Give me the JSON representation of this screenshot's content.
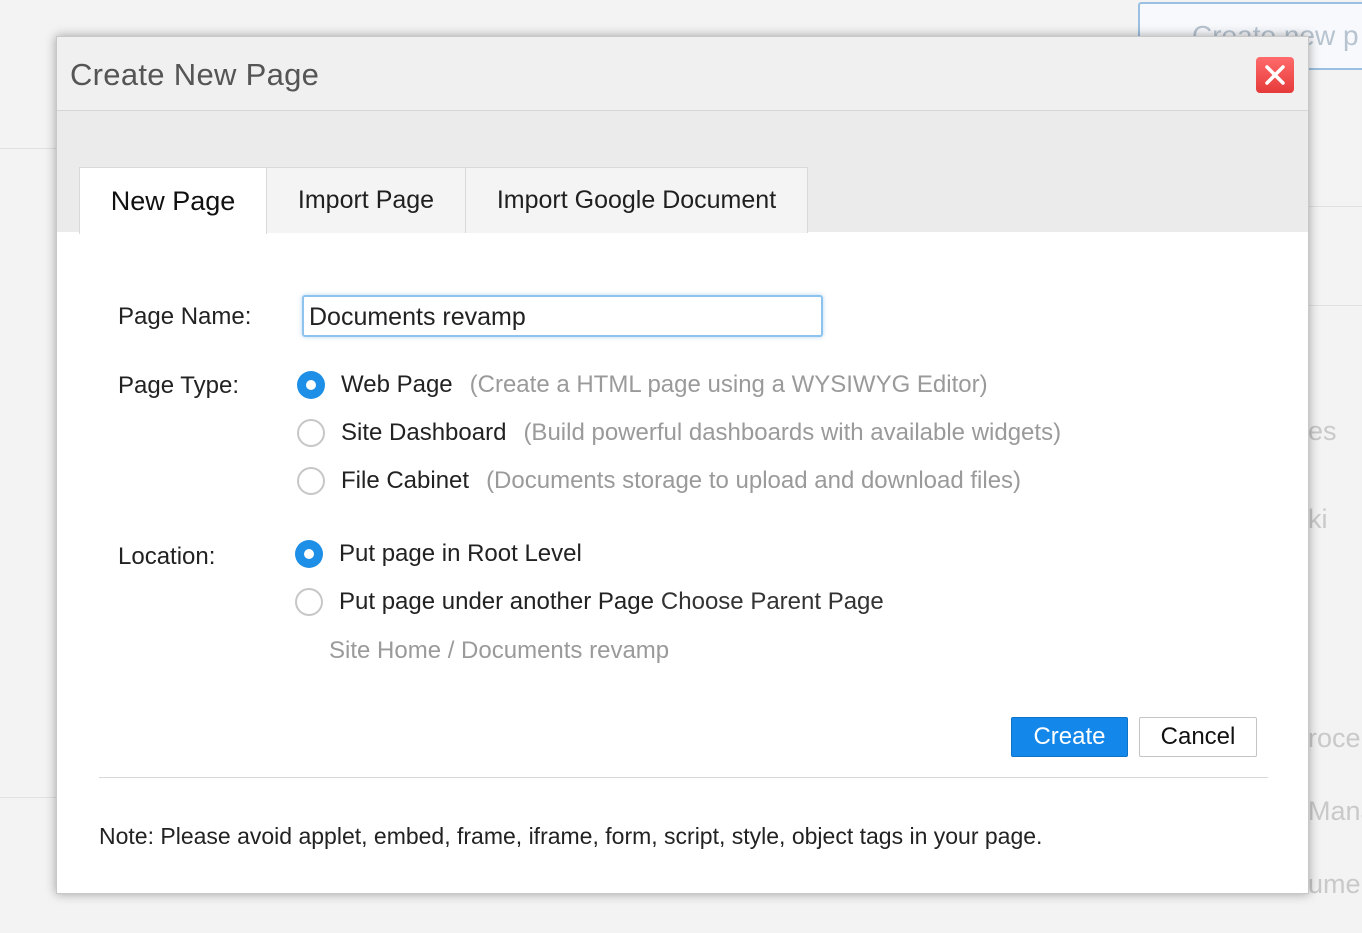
{
  "background": {
    "create_button_label": "Create new p",
    "side_fragments": [
      "es",
      "ki",
      "roce",
      "Mana",
      "umer"
    ]
  },
  "modal": {
    "title": "Create New Page",
    "close_icon": "close-icon",
    "tabs": [
      {
        "label": "New Page",
        "active": true
      },
      {
        "label": "Import Page",
        "active": false
      },
      {
        "label": "Import Google Document",
        "active": false
      }
    ],
    "page_name": {
      "label": "Page Name:",
      "value": "Documents revamp"
    },
    "page_type": {
      "label": "Page Type:",
      "options": [
        {
          "label": "Web Page",
          "description": "(Create a HTML page using a WYSIWYG Editor)",
          "checked": true
        },
        {
          "label": "Site Dashboard",
          "description": "(Build powerful dashboards with available widgets)",
          "checked": false
        },
        {
          "label": "File Cabinet",
          "description": "(Documents storage to upload and download files)",
          "checked": false
        }
      ]
    },
    "location": {
      "label": "Location:",
      "options": [
        {
          "label": "Put page in Root Level",
          "checked": true
        },
        {
          "label": "Put page under another Page",
          "checked": false
        }
      ],
      "choose_parent_link": "Choose Parent Page",
      "breadcrumb": "Site Home /  Documents revamp"
    },
    "buttons": {
      "create": "Create",
      "cancel": "Cancel"
    },
    "note": "Note: Please avoid applet, embed, frame, iframe, form, script, style, object tags in your page."
  },
  "colors": {
    "accent": "#1487ea",
    "radio_checked": "#1e8fe6",
    "close_button": "#e63a3a"
  }
}
